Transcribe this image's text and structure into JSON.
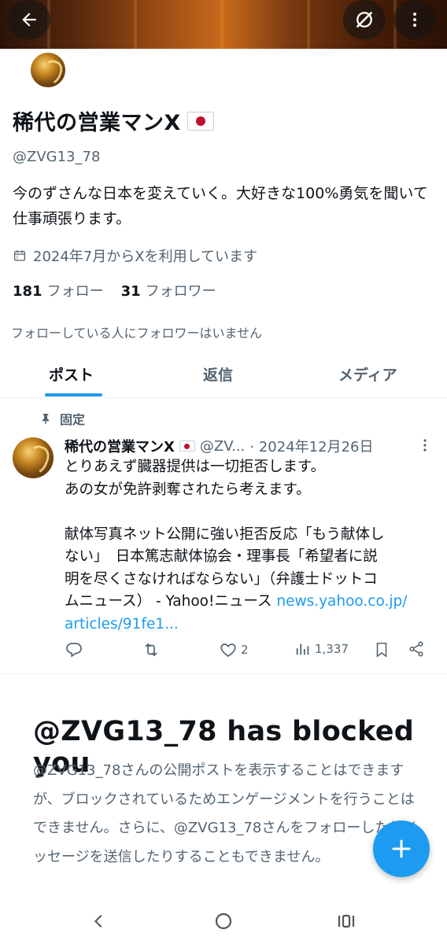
{
  "profile": {
    "display_name": "稀代の営業マンX",
    "handle": "@ZVG13_78",
    "bio": "今のずさんな日本を変えていく。大好きな100%勇気を聞いて仕事頑張ります。",
    "joined": "2024年7月からXを利用しています",
    "following_count": "181",
    "following_label": "フォロー",
    "followers_count": "31",
    "followers_label": "フォロワー",
    "mutual_note": "フォローしている人にフォロワーはいません"
  },
  "tabs": [
    {
      "label": "ポスト",
      "active": true
    },
    {
      "label": "返信",
      "active": false
    },
    {
      "label": "メディア",
      "active": false
    }
  ],
  "post": {
    "pinned_label": "固定",
    "author_name": "稀代の営業マンX",
    "author_handle": "@ZV...",
    "date": "· 2024年12月26日",
    "lines": [
      "とりあえず臓器提供は一切拒否します。",
      "あの女が免許剥奪されたら考えます。"
    ],
    "lines2": [
      "献体写真ネット公開に強い拒否反応「もう献体し",
      "ない」　日本篤志献体協会・理事長「希望者に説",
      "明を尽くさなければならない」（弁護士ドットコ"
    ],
    "last_line_text": "ムニュース） - Yahoo!ニュース ",
    "link_part1": "news.yahoo.co.jp/",
    "link_part2": "articles/91fe1...",
    "likes": "2",
    "views": "1,337"
  },
  "blocked": {
    "title": "@ZVG13_78 has blocked you",
    "description": "@ZVG13_78さんの公開ポストを表示することはできますが、ブロックされているためエンゲージメントを行うことはできません。さらに、@ZVG13_78さんをフォローしたりメッセージを送信したりすることもできません。"
  },
  "colors": {
    "accent": "#1d9bf0",
    "text_primary": "#0f1419",
    "text_secondary": "#536471"
  },
  "icons": [
    "back-arrow-icon",
    "grok-icon",
    "more-vertical-icon",
    "calendar-icon",
    "pin-icon",
    "reply-icon",
    "repost-icon",
    "like-icon",
    "views-icon",
    "bookmark-icon",
    "share-icon",
    "plus-icon",
    "nav-back-icon",
    "nav-home-icon",
    "nav-recents-icon"
  ]
}
